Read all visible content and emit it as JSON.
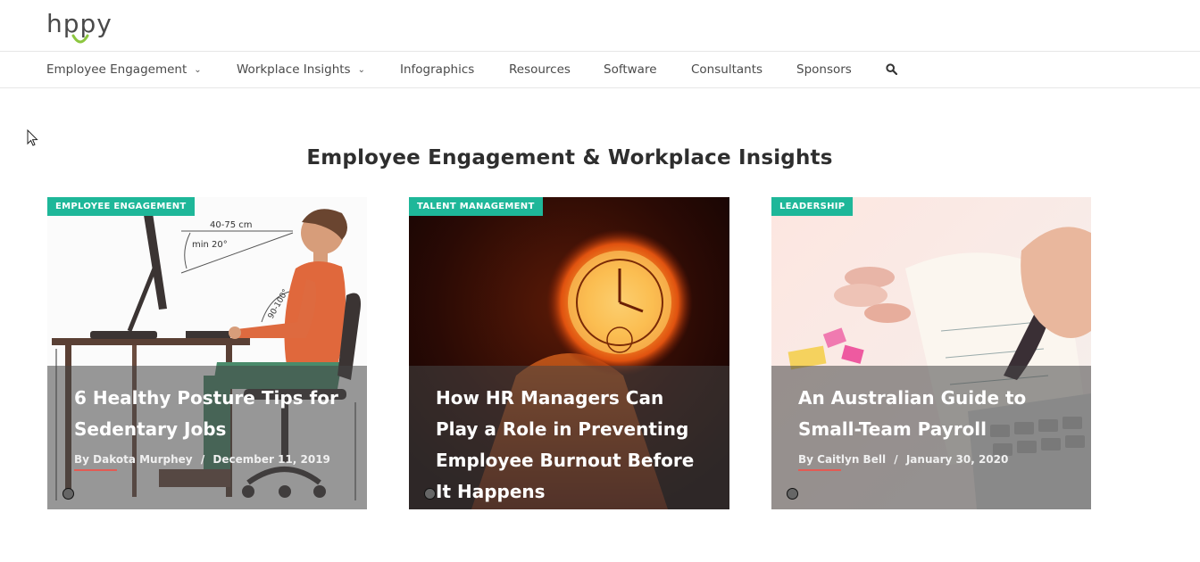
{
  "header": {
    "logo_text": "hppy"
  },
  "nav": {
    "items": [
      {
        "label": "Employee Engagement",
        "has_dropdown": true
      },
      {
        "label": "Workplace Insights",
        "has_dropdown": true
      },
      {
        "label": "Infographics",
        "has_dropdown": false
      },
      {
        "label": "Resources",
        "has_dropdown": false
      },
      {
        "label": "Software",
        "has_dropdown": false
      },
      {
        "label": "Consultants",
        "has_dropdown": false
      },
      {
        "label": "Sponsors",
        "has_dropdown": false
      }
    ],
    "search_icon": "search-icon"
  },
  "section": {
    "title": "Employee Engagement & Workplace Insights"
  },
  "cards": [
    {
      "category": "EMPLOYEE ENGAGEMENT",
      "title": "6 Healthy Posture Tips for Sedentary Jobs",
      "author": "By Dakota Murphey",
      "date": "December 11, 2019",
      "separator": "/",
      "image_labels": {
        "distance": "40-75 cm",
        "angle": "min 20°",
        "knee": "90-100°"
      }
    },
    {
      "category": "TALENT MANAGEMENT",
      "title": "How HR Managers Can Play a Role in Preventing Employee Burnout Before It Happens",
      "author": "",
      "date": "",
      "separator": ""
    },
    {
      "category": "LEADERSHIP",
      "title": "An Australian Guide to Small-Team Payroll",
      "author": "By Caitlyn Bell",
      "date": "January 30, 2020",
      "separator": "/"
    }
  ],
  "colors": {
    "accent": "#1eb799",
    "underline": "#e35b54",
    "logo_smile": "#8cc63f"
  }
}
